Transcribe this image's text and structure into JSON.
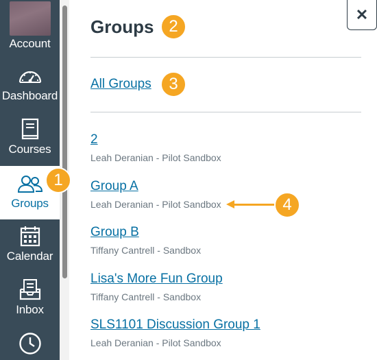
{
  "global_nav": {
    "items": [
      {
        "label": "Account",
        "icon": "avatar"
      },
      {
        "label": "Dashboard",
        "icon": "dashboard-icon"
      },
      {
        "label": "Courses",
        "icon": "courses-icon"
      },
      {
        "label": "Groups",
        "icon": "groups-icon",
        "active": true
      },
      {
        "label": "Calendar",
        "icon": "calendar-icon"
      },
      {
        "label": "Inbox",
        "icon": "inbox-icon"
      },
      {
        "label": "",
        "icon": "history-clock-icon"
      }
    ]
  },
  "tray": {
    "title": "Groups",
    "all_groups_label": "All Groups",
    "close_label": "✕",
    "groups": [
      {
        "name": "2",
        "course": "Leah Deranian - Pilot Sandbox"
      },
      {
        "name": "Group A",
        "course": "Leah Deranian - Pilot Sandbox"
      },
      {
        "name": "Group B",
        "course": "Tiffany Cantrell - Sandbox"
      },
      {
        "name": "Lisa's More Fun Group",
        "course": "Tiffany Cantrell - Sandbox"
      },
      {
        "name": "SLS1101 Discussion Group 1",
        "course": "Leah Deranian - Pilot Sandbox"
      }
    ]
  },
  "callouts": [
    "1",
    "2",
    "3",
    "4"
  ],
  "colors": {
    "nav_bg": "#394b58",
    "link": "#0770a3",
    "callout": "#f5a623",
    "text_dark": "#2d3b45",
    "text_muted": "#6b7780"
  }
}
